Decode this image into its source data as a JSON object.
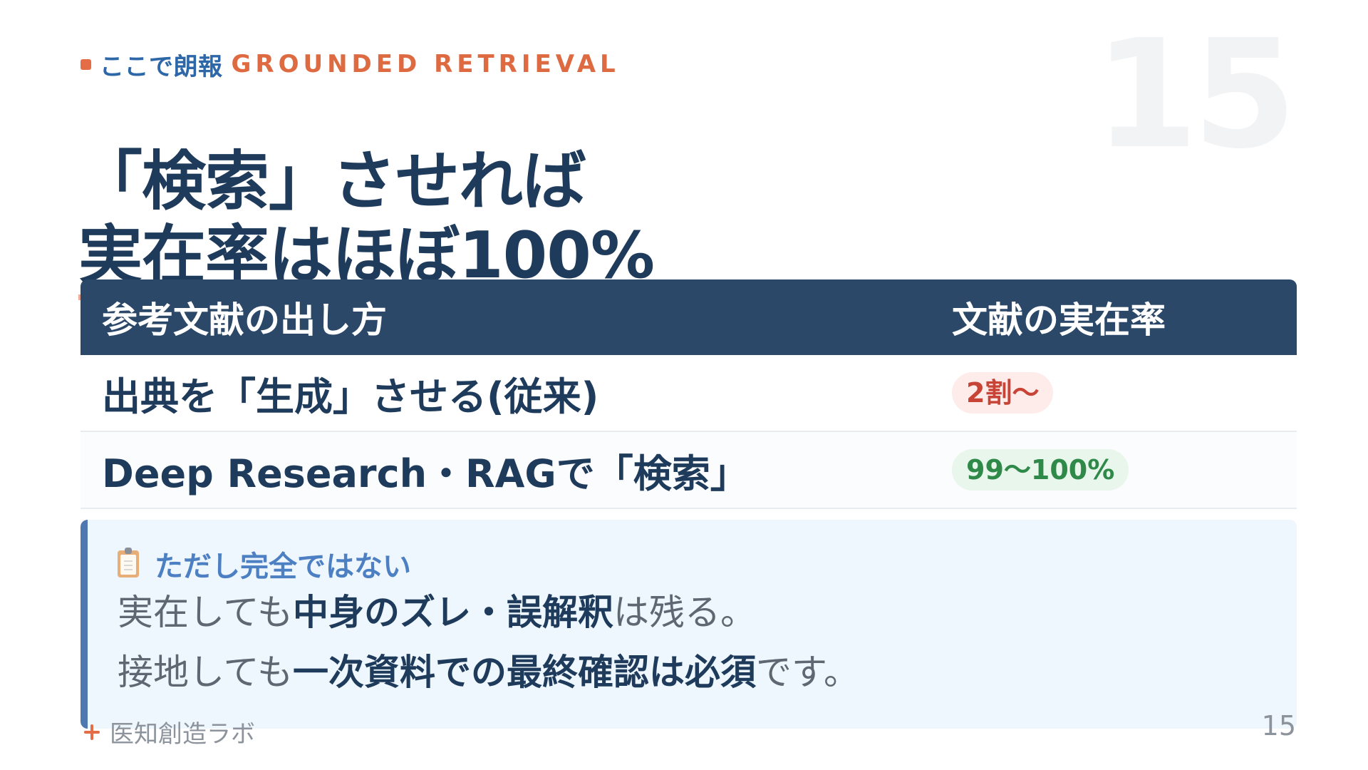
{
  "slide": {
    "background_number": "15",
    "eyebrow": {
      "ja": "ここで朗報",
      "en": "GROUNDED RETRIEVAL"
    },
    "title": {
      "line1": "「検索」させれば",
      "line2": "実在率はほぼ100%"
    },
    "table": {
      "headers": {
        "method": "参考文献の出し方",
        "rate": "文献の実在率"
      },
      "rows": [
        {
          "method": "出典を「生成」させる(従来)",
          "rate": "2割〜",
          "rate_status": "low"
        },
        {
          "method": "Deep Research・RAGで「検索」",
          "rate": "99〜100%",
          "rate_status": "high"
        }
      ]
    },
    "note": {
      "icon": "clipboard-icon",
      "title": "ただし完全ではない",
      "line1": {
        "before": "実在しても",
        "strong": "中身のズレ・誤解釈",
        "after": "は残る。"
      },
      "line2": {
        "before": "接地しても",
        "strong": "一次資料での最終確認は必須",
        "after": "です。"
      }
    },
    "footer": {
      "brand": "医知創造ラボ",
      "page": "15"
    },
    "colors": {
      "navy": "#1f3b5b",
      "header_navy": "#2c4868",
      "accent_orange": "#e46c47",
      "underline_salmon": "#f1a995",
      "note_blue": "#4d7fc3",
      "note_background": "#eef6fe",
      "badge_red": "#c74436",
      "badge_green": "#2f8a49"
    }
  }
}
